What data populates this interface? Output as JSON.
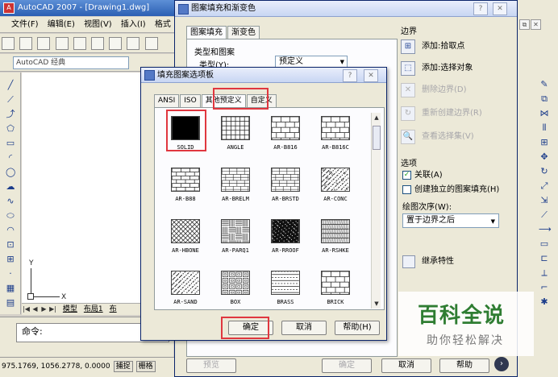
{
  "acad": {
    "title": "AutoCAD 2007 - [Drawing1.dwg]",
    "logo": "A",
    "menu": [
      "文件(F)",
      "编辑(E)",
      "视图(V)",
      "插入(I)",
      "格式"
    ],
    "workspace": "AutoCAD 经典",
    "ucs_x": "X",
    "ucs_y": "Y",
    "layout_tab_model": "模型",
    "layout_tab_1": "布局1",
    "layout_tab_2": "布",
    "command_prompt": "命令:",
    "coordinates": "975.1769,  1056.2778, 0.0000",
    "snap_button": "捕捉",
    "grid_button": "栅格"
  },
  "hatch": {
    "title": "图案填充和渐变色",
    "help_btn": "?",
    "close_btn": "✕",
    "tab_hatch": "图案填充",
    "tab_gradient": "渐变色",
    "group_type": "类型和图案",
    "type_label": "类型(Y):",
    "type_value": "预定义",
    "group_boundary": "边界",
    "boundary_items": [
      {
        "label": "添加:拾取点",
        "icon": "pick-points-icon",
        "glyph": "⊞"
      },
      {
        "label": "添加:选择对象",
        "icon": "select-objects-icon",
        "glyph": "⬚"
      },
      {
        "label": "删除边界(D)",
        "icon": "remove-boundary-icon",
        "glyph": "✕"
      },
      {
        "label": "重新创建边界(R)",
        "icon": "recreate-boundary-icon",
        "glyph": "↻"
      },
      {
        "label": "查看选择集(V)",
        "icon": "view-selection-icon",
        "glyph": "🔍"
      }
    ],
    "group_options": "选项",
    "opt_associative": "关联(A)",
    "opt_associative_check": "✓",
    "opt_separate": "创建独立的图案填充(H)",
    "draw_order_label": "绘图次序(W):",
    "draw_order_value": "置于边界之后",
    "inherit_label": "继承特性",
    "footer_preview": "预览",
    "footer_ok": "确定",
    "footer_cancel": "取消",
    "footer_help": "帮助",
    "more_btn": "›"
  },
  "palette": {
    "title": "填充图案选项板",
    "help_btn": "?",
    "close_btn": "✕",
    "tabs": [
      "ANSI",
      "ISO",
      "其他预定义",
      "自定义"
    ],
    "swatches": [
      "SOLID",
      "ANGLE",
      "AR-B816",
      "AR-B816C",
      "AR-B88",
      "AR-BRELM",
      "AR-BRSTD",
      "AR-CONC",
      "AR-HBONE",
      "AR-PARQ1",
      "AR-RROOF",
      "AR-RSHKE",
      "AR-SAND",
      "BOX",
      "BRASS",
      "BRICK"
    ],
    "ok": "确定",
    "cancel": "取消",
    "help": "帮助(H)"
  },
  "watermark": {
    "title": "百科全说",
    "subtitle": "助你轻松解决"
  }
}
